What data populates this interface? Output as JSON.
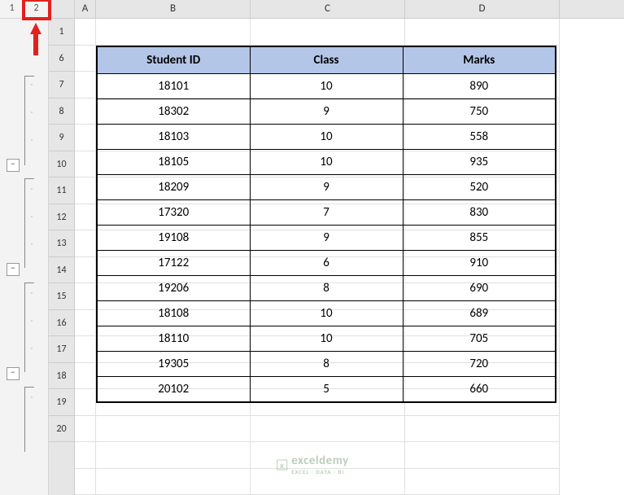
{
  "outline_levels": [
    "1",
    "2"
  ],
  "collapse_symbol": "−",
  "row_numbers": [
    "1",
    "6",
    "7",
    "8",
    "9",
    "10",
    "11",
    "12",
    "13",
    "14",
    "15",
    "16",
    "17",
    "18",
    "19",
    "20"
  ],
  "col_headers": [
    "A",
    "B",
    "C",
    "D"
  ],
  "table": {
    "headers": [
      "Student ID",
      "Class",
      "Marks"
    ],
    "rows": [
      [
        "18101",
        "10",
        "890"
      ],
      [
        "18302",
        "9",
        "750"
      ],
      [
        "18103",
        "10",
        "558"
      ],
      [
        "18105",
        "10",
        "935"
      ],
      [
        "18209",
        "9",
        "520"
      ],
      [
        "17320",
        "7",
        "830"
      ],
      [
        "19108",
        "9",
        "855"
      ],
      [
        "17122",
        "6",
        "910"
      ],
      [
        "19206",
        "8",
        "690"
      ],
      [
        "18108",
        "10",
        "689"
      ],
      [
        "18110",
        "10",
        "705"
      ],
      [
        "19305",
        "8",
        "720"
      ],
      [
        "20102",
        "5",
        "660"
      ]
    ]
  },
  "watermark": {
    "brand": "exceldemy",
    "tag": "EXCEL · DATA · BI"
  },
  "chart_data": {
    "type": "table",
    "title": "",
    "columns": [
      "Student ID",
      "Class",
      "Marks"
    ],
    "rows": [
      [
        18101,
        10,
        890
      ],
      [
        18302,
        9,
        750
      ],
      [
        18103,
        10,
        558
      ],
      [
        18105,
        10,
        935
      ],
      [
        18209,
        9,
        520
      ],
      [
        17320,
        7,
        830
      ],
      [
        19108,
        9,
        855
      ],
      [
        17122,
        6,
        910
      ],
      [
        19206,
        8,
        690
      ],
      [
        18108,
        10,
        689
      ],
      [
        18110,
        10,
        705
      ],
      [
        19305,
        8,
        720
      ],
      [
        20102,
        5,
        660
      ]
    ]
  }
}
